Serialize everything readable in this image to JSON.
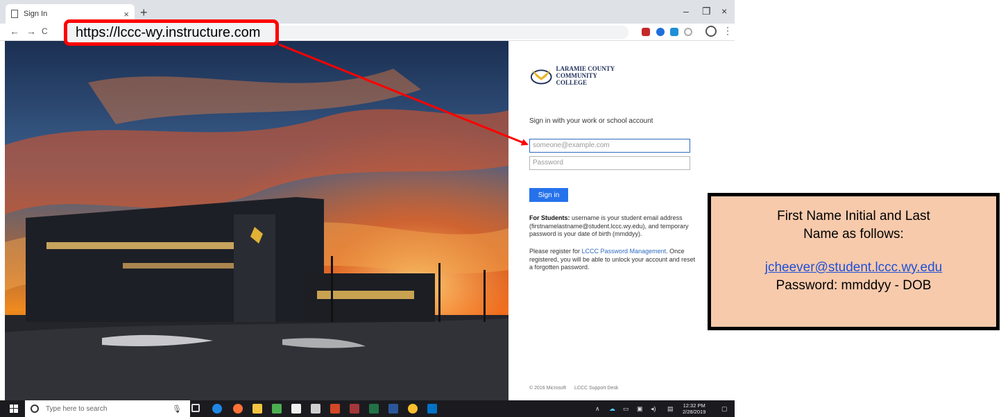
{
  "browser": {
    "tab_title": "Sign In",
    "tab_close": "×",
    "new_tab": "+",
    "url": "https://lccc-wy.instructure.com",
    "win_minimize": "–",
    "win_restore": "❐",
    "win_close": "×",
    "nav_back": "←",
    "nav_forward": "→",
    "nav_reload": "C",
    "menu": "⋮"
  },
  "signin": {
    "logo_line1": "LARAMIE COUNTY",
    "logo_line2": "COMMUNITY COLLEGE",
    "prompt": "Sign in with your work or school account",
    "email_placeholder": "someone@example.com",
    "password_placeholder": "Password",
    "button": "Sign in",
    "students_label": "For Students:",
    "students_text": " username is your student email address (firstnamelastname@student.lccc.wy.edu), and temporary password is your date of birth (mmddyy).",
    "register_prefix": "Please register for ",
    "register_link": "LCCC Password Management",
    "register_suffix": ". Once registered, you will be able to unlock your account and reset a forgotten password.",
    "footer_copyright": "© 2016 Microsoft",
    "footer_support": "LCCC Support Desk"
  },
  "taskbar": {
    "search_placeholder": "Type here to search",
    "time": "12:32 PM",
    "date": "2/28/2019"
  },
  "callout": {
    "line1": "First Name Initial and Last",
    "line2": "Name as follows:",
    "email": "jcheever@student.lccc.wy.edu",
    "password_line": "Password:  mmddyy - DOB"
  },
  "colors": {
    "highlight_red": "#ff0000",
    "callout_bg": "#f7caac",
    "signin_blue": "#2672ec"
  }
}
